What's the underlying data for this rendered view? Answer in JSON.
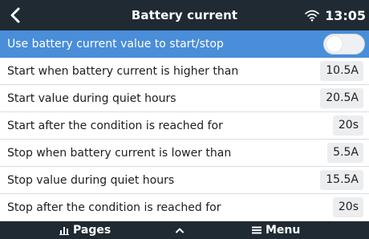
{
  "header": {
    "back_icon": "chevron-left-icon",
    "title": "Battery current",
    "wifi_icon": "wifi-icon",
    "clock": "13:05"
  },
  "rows": [
    {
      "label": "Use battery current value to start/stop",
      "toggle_on": false
    },
    {
      "label": "Start when battery current is higher than",
      "value": "10.5A"
    },
    {
      "label": "Start value during quiet hours",
      "value": "20.5A"
    },
    {
      "label": "Start after the condition is reached for",
      "value": "20s"
    },
    {
      "label": "Stop when battery current is lower than",
      "value": "5.5A"
    },
    {
      "label": "Stop value during quiet hours",
      "value": "15.5A"
    },
    {
      "label": "Stop after the condition is reached for",
      "value": "20s"
    }
  ],
  "footer": {
    "pages_label": "Pages",
    "pages_icon": "bar-chart-icon",
    "up_icon": "chevron-up-icon",
    "menu_label": "Menu",
    "menu_icon": "hamburger-icon"
  },
  "colors": {
    "header_bg": "#1f2a33",
    "selected_row": "#4a8dd8",
    "value_box": "#ebedef"
  }
}
